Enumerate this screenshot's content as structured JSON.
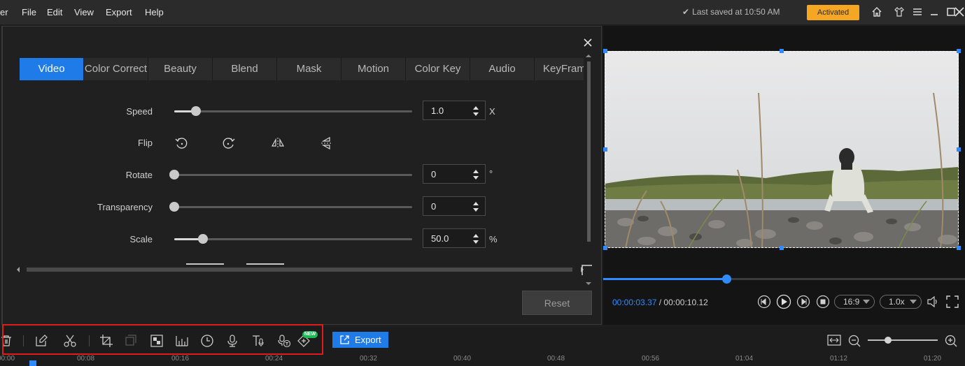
{
  "menubar": {
    "app_title_fragment": "er",
    "items": [
      "File",
      "Edit",
      "View",
      "Export",
      "Help"
    ],
    "save_status": "Last saved at 10:50 AM",
    "activation": "Activated"
  },
  "panel": {
    "tabs": [
      "Video",
      "Color Correct",
      "Beauty",
      "Blend",
      "Mask",
      "Motion",
      "Color Key",
      "Audio",
      "KeyFram"
    ],
    "active_tab": "Video",
    "speed": {
      "label": "Speed",
      "value": "1.0",
      "unit": "X",
      "level": 0.09
    },
    "flip": {
      "label": "Flip",
      "icons": [
        "rotate-left-icon",
        "rotate-right-icon",
        "flip-horizontal-icon",
        "flip-vertical-icon"
      ]
    },
    "rotate": {
      "label": "Rotate",
      "value": "0",
      "unit": "°",
      "level": 0.0
    },
    "transparency": {
      "label": "Transparency",
      "value": "0",
      "level": 0.0
    },
    "scale": {
      "label": "Scale",
      "value": "50.0",
      "unit": "%",
      "level": 0.12
    },
    "reset_label": "Reset"
  },
  "preview": {
    "current_time": "00:00:03.37",
    "separator": " / ",
    "total_time": "00:00:10.12",
    "progress": 0.34,
    "aspect_ratio": "16:9",
    "playback_speed": "1.0x"
  },
  "toolbar": {
    "export_label": "Export",
    "new_badge": "NEW",
    "icons": [
      "delete-icon",
      "edit-icon",
      "split-icon",
      "crop-icon",
      "freeze-icon",
      "mosaic-icon",
      "audio-levels-icon",
      "duration-icon",
      "record-voice-icon",
      "text-to-speech-icon",
      "speech-to-text-icon",
      "ai-tool-icon"
    ]
  },
  "timeline": {
    "ticks": [
      "00:00",
      "00:08",
      "00:16",
      "00:24",
      "00:32",
      "00:40",
      "00:48",
      "00:56",
      "01:04",
      "01:12",
      "01:20"
    ],
    "zoom_level": 0.29
  },
  "colors": {
    "accent": "#1f7be8",
    "activated": "#f5a623",
    "highlight": "#e01b1b",
    "badge": "#1db954"
  }
}
